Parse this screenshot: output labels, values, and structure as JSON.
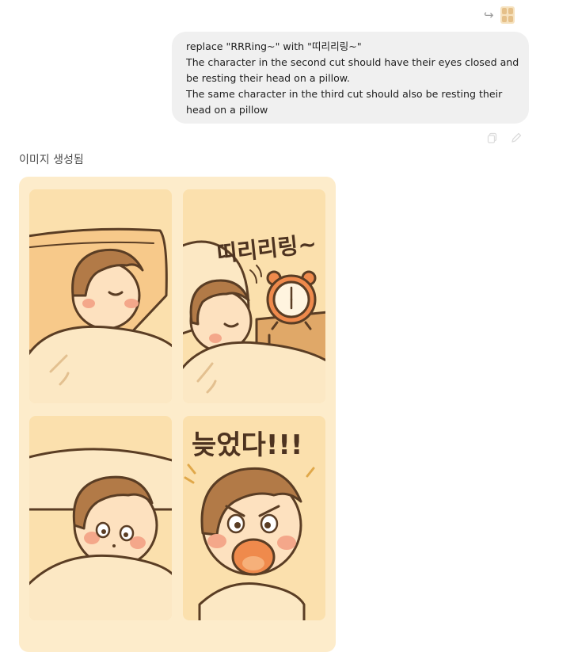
{
  "message": {
    "lines": [
      "replace \"RRRing~\" with \"띠리리링~\"",
      "The character in the second cut should have their eyes closed and",
      "be resting their head on a pillow.",
      "The same character in the third cut should also be resting their",
      "head on a pillow"
    ]
  },
  "icons": {
    "reply": "reply-arrow-icon",
    "attachment": "attachment-thumbnail",
    "copy": "copy-icon",
    "edit": "edit-pencil-icon"
  },
  "response": {
    "label": "이미지 생성됨"
  },
  "comic": {
    "panel2_sfx": "띠리리링~",
    "panel4_text": "늦었다!!!"
  },
  "colors": {
    "bubble": "#f0f0f0",
    "comic_bg": "#fdeccb",
    "panel_bg": "#fbe0ad",
    "outline": "#5a3d24",
    "hair": "#b27a47",
    "clock": "#ef8a4c"
  }
}
